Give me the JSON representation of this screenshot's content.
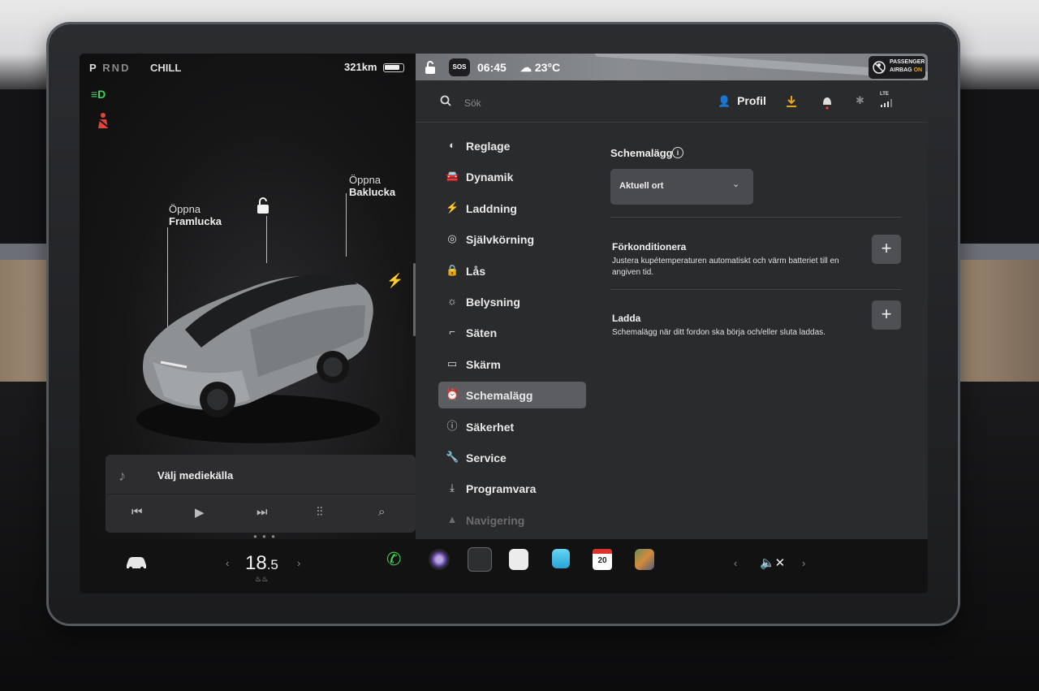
{
  "status": {
    "gear_parked": "P",
    "gear_rest": "RND",
    "drive_mode": "CHILL",
    "range": "321km",
    "battery_level": 0.8,
    "time": "06:45",
    "temperature": "23°C",
    "sos": "SOS",
    "airbag_line1": "PASSENGER",
    "airbag_line2": "AIRBAG",
    "airbag_state": "ON"
  },
  "car_panel": {
    "frunk_label_1": "Öppna",
    "frunk_label_2": "Framlucka",
    "trunk_label_1": "Öppna",
    "trunk_label_2": "Baklucka"
  },
  "media": {
    "source_label": "Välj mediekälla"
  },
  "toolbar": {
    "search_placeholder": "Sök",
    "profile_label": "Profil",
    "lte_label": "LTE"
  },
  "nav": [
    {
      "icon": "toggle-icon",
      "glyph": "◐",
      "label": "Reglage"
    },
    {
      "icon": "car-icon",
      "glyph": "🚘",
      "label": "Dynamik"
    },
    {
      "icon": "bolt-icon",
      "glyph": "⚡",
      "label": "Laddning"
    },
    {
      "icon": "steering-wheel-icon",
      "glyph": "◎",
      "label": "Självkörning"
    },
    {
      "icon": "lock-icon",
      "glyph": "🔒",
      "label": "Lås"
    },
    {
      "icon": "light-icon",
      "glyph": "☼",
      "label": "Belysning"
    },
    {
      "icon": "seat-icon",
      "glyph": "⌐",
      "label": "Säten"
    },
    {
      "icon": "display-icon",
      "glyph": "▭",
      "label": "Skärm"
    },
    {
      "icon": "alarm-clock-icon",
      "glyph": "⏰",
      "label": "Schemalägg"
    },
    {
      "icon": "alert-icon",
      "glyph": "ⓘ",
      "label": "Säkerhet"
    },
    {
      "icon": "wrench-icon",
      "glyph": "🔧",
      "label": "Service"
    },
    {
      "icon": "download-icon",
      "glyph": "⤓",
      "label": "Programvara"
    },
    {
      "icon": "navigation-icon",
      "glyph": "▲",
      "label": "Navigering"
    }
  ],
  "content": {
    "title": "Schemalägg",
    "location_value": "Aktuell ort",
    "precondition_title": "Förkonditionera",
    "precondition_desc": "Justera kupétemperaturen automatiskt och värm batteriet till en angiven tid.",
    "charge_title": "Ladda",
    "charge_desc": "Schemalägg när ditt fordon ska börja och/eller sluta laddas.",
    "plus": "+"
  },
  "bottom": {
    "temp_main": "18",
    "temp_decimal": ".5",
    "calendar_day": "20"
  },
  "colors": {
    "accent_download": "#e8a316",
    "active_nav": "#5b5d61",
    "indicator_green": "#42d15a",
    "indicator_red": "#e0443a"
  }
}
